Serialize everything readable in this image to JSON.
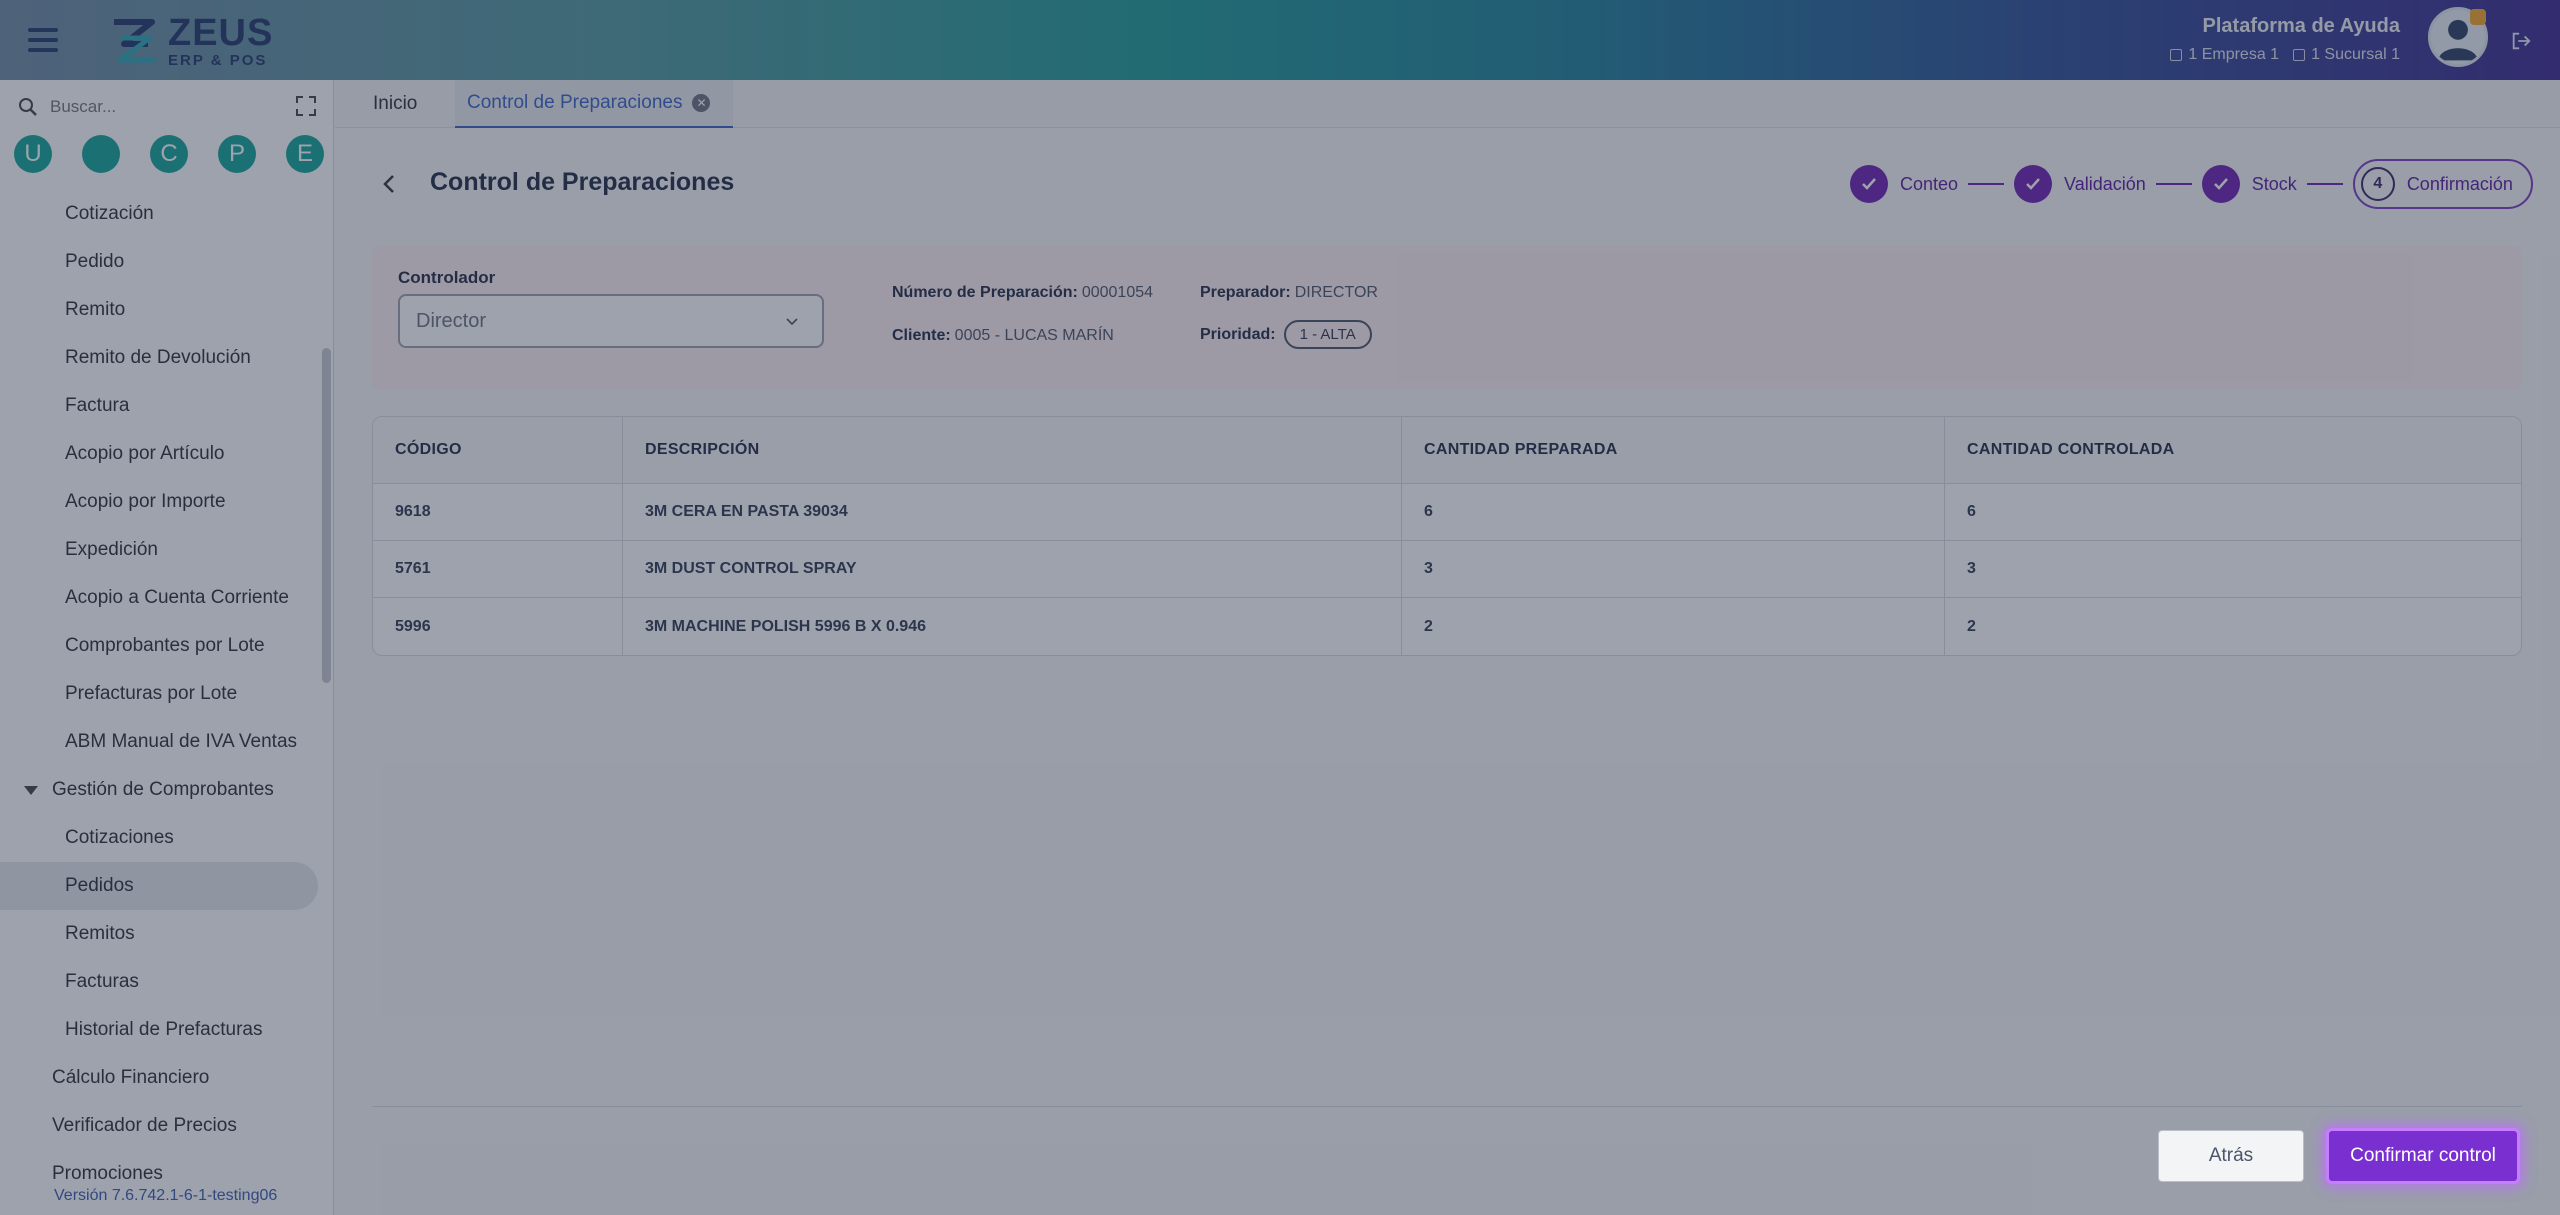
{
  "header": {
    "logo_name": "ZEUS",
    "logo_sub": "ERP & POS",
    "help_title": "Plataforma de Ayuda",
    "company": "1 Empresa 1",
    "branch": "1 Sucursal 1"
  },
  "sidebar": {
    "search_placeholder": "Buscar...",
    "shortcuts": [
      "U",
      "",
      "C",
      "P",
      "E"
    ],
    "items": [
      {
        "label": "Cotización"
      },
      {
        "label": "Pedido"
      },
      {
        "label": "Remito"
      },
      {
        "label": "Remito de Devolución"
      },
      {
        "label": "Factura"
      },
      {
        "label": "Acopio por Artículo"
      },
      {
        "label": "Acopio por Importe"
      },
      {
        "label": "Expedición"
      },
      {
        "label": "Acopio a Cuenta Corriente"
      },
      {
        "label": "Comprobantes por Lote"
      },
      {
        "label": "Prefacturas por Lote"
      },
      {
        "label": "ABM Manual de IVA Ventas"
      },
      {
        "label": "Gestión de Comprobantes"
      },
      {
        "label": "Cotizaciones"
      },
      {
        "label": "Pedidos"
      },
      {
        "label": "Remitos"
      },
      {
        "label": "Facturas"
      },
      {
        "label": "Historial de Prefacturas"
      },
      {
        "label": "Cálculo Financiero"
      },
      {
        "label": "Verificador de Precios"
      },
      {
        "label": "Promociones"
      }
    ],
    "version": "Versión 7.6.742.1-6-1-testing06"
  },
  "tabs": {
    "home": "Inicio",
    "current": "Control de Preparaciones"
  },
  "page": {
    "title": "Control de Preparaciones"
  },
  "stepper": {
    "steps": [
      "Conteo",
      "Validación",
      "Stock",
      "Confirmación"
    ],
    "current_number": "4"
  },
  "info": {
    "controller_label": "Controlador",
    "controller_value": "Director",
    "prep_number_label": "Número de Preparación:",
    "prep_number": "00001054",
    "client_label": "Cliente:",
    "client": "0005 - LUCAS MARÍN",
    "preparer_label": "Preparador:",
    "preparer": "DIRECTOR",
    "priority_label": "Prioridad:",
    "priority": "1 - ALTA"
  },
  "table": {
    "headers": [
      "CÓDIGO",
      "DESCRIPCIÓN",
      "CANTIDAD PREPARADA",
      "CANTIDAD CONTROLADA"
    ],
    "rows": [
      [
        "9618",
        "3M CERA EN PASTA 39034",
        "6",
        "6"
      ],
      [
        "5761",
        "3M DUST CONTROL SPRAY",
        "3",
        "3"
      ],
      [
        "5996",
        "3M MACHINE POLISH 5996 B X 0.946",
        "2",
        "2"
      ]
    ]
  },
  "footer": {
    "back_label": "Atrás",
    "confirm_label": "Confirmar control"
  }
}
